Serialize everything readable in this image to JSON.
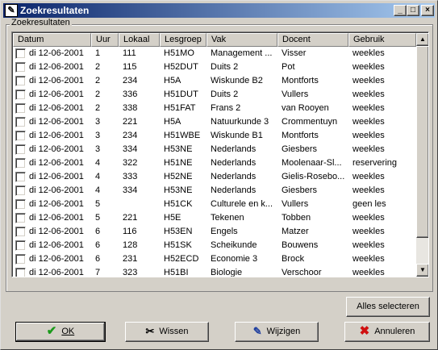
{
  "window": {
    "title": "Zoekresultaten",
    "minimize_glyph": "_",
    "maximize_glyph": "□",
    "close_glyph": "×"
  },
  "group": {
    "label": "Zoekresultaten"
  },
  "columns": [
    "Datum",
    "Uur",
    "Lokaal",
    "Lesgroep",
    "Vak",
    "Docent",
    "Gebruik"
  ],
  "rows": [
    {
      "datum": "di 12-06-2001",
      "uur": "1",
      "lokaal": "111",
      "lesgroep": "H51MO",
      "vak": "Management ...",
      "docent": "Visser",
      "gebruik": "weekles"
    },
    {
      "datum": "di 12-06-2001",
      "uur": "2",
      "lokaal": "115",
      "lesgroep": "H52DUT",
      "vak": "Duits 2",
      "docent": "Pot",
      "gebruik": "weekles"
    },
    {
      "datum": "di 12-06-2001",
      "uur": "2",
      "lokaal": "234",
      "lesgroep": "H5A",
      "vak": "Wiskunde B2",
      "docent": "Montforts",
      "gebruik": "weekles"
    },
    {
      "datum": "di 12-06-2001",
      "uur": "2",
      "lokaal": "336",
      "lesgroep": "H51DUT",
      "vak": "Duits 2",
      "docent": "Vullers",
      "gebruik": "weekles"
    },
    {
      "datum": "di 12-06-2001",
      "uur": "2",
      "lokaal": "338",
      "lesgroep": "H51FAT",
      "vak": "Frans 2",
      "docent": "van Rooyen",
      "gebruik": "weekles"
    },
    {
      "datum": "di 12-06-2001",
      "uur": "3",
      "lokaal": "221",
      "lesgroep": "H5A",
      "vak": "Natuurkunde 3",
      "docent": "Crommentuyn",
      "gebruik": "weekles"
    },
    {
      "datum": "di 12-06-2001",
      "uur": "3",
      "lokaal": "234",
      "lesgroep": "H51WBE",
      "vak": "Wiskunde B1",
      "docent": "Montforts",
      "gebruik": "weekles"
    },
    {
      "datum": "di 12-06-2001",
      "uur": "3",
      "lokaal": "334",
      "lesgroep": "H53NE",
      "vak": "Nederlands",
      "docent": "Giesbers",
      "gebruik": "weekles"
    },
    {
      "datum": "di 12-06-2001",
      "uur": "4",
      "lokaal": "322",
      "lesgroep": "H51NE",
      "vak": "Nederlands",
      "docent": "Moolenaar-Sl...",
      "gebruik": "reservering"
    },
    {
      "datum": "di 12-06-2001",
      "uur": "4",
      "lokaal": "333",
      "lesgroep": "H52NE",
      "vak": "Nederlands",
      "docent": "Gielis-Rosebo...",
      "gebruik": "weekles"
    },
    {
      "datum": "di 12-06-2001",
      "uur": "4",
      "lokaal": "334",
      "lesgroep": "H53NE",
      "vak": "Nederlands",
      "docent": "Giesbers",
      "gebruik": "weekles"
    },
    {
      "datum": "di 12-06-2001",
      "uur": "5",
      "lokaal": "",
      "lesgroep": "H51CK",
      "vak": "Culturele en k...",
      "docent": "Vullers",
      "gebruik": "geen les"
    },
    {
      "datum": "di 12-06-2001",
      "uur": "5",
      "lokaal": "221",
      "lesgroep": "H5E",
      "vak": "Tekenen",
      "docent": "Tobben",
      "gebruik": "weekles"
    },
    {
      "datum": "di 12-06-2001",
      "uur": "6",
      "lokaal": "116",
      "lesgroep": "H53EN",
      "vak": "Engels",
      "docent": "Matzer",
      "gebruik": "weekles"
    },
    {
      "datum": "di 12-06-2001",
      "uur": "6",
      "lokaal": "128",
      "lesgroep": "H51SK",
      "vak": "Scheikunde",
      "docent": "Bouwens",
      "gebruik": "weekles"
    },
    {
      "datum": "di 12-06-2001",
      "uur": "6",
      "lokaal": "231",
      "lesgroep": "H52ECD",
      "vak": "Economie 3",
      "docent": "Brock",
      "gebruik": "weekles"
    },
    {
      "datum": "di 12-06-2001",
      "uur": "7",
      "lokaal": "323",
      "lesgroep": "H51BI",
      "vak": "Biologie",
      "docent": "Verschoor",
      "gebruik": "weekles"
    }
  ],
  "buttons": {
    "select_all": "Alles selecteren",
    "ok": "OK",
    "wissen": "Wissen",
    "wijzigen": "Wijzigen",
    "annuleren": "Annuleren"
  },
  "scrollbar": {
    "up_glyph": "▲",
    "down_glyph": "▼"
  }
}
